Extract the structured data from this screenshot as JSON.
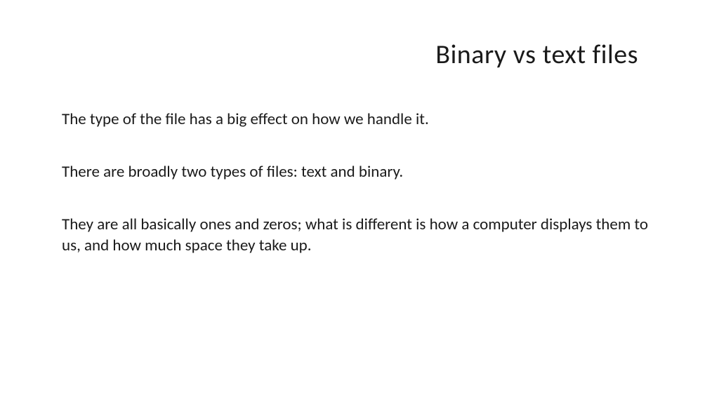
{
  "slide": {
    "title": "Binary vs text files",
    "paragraphs": [
      "The type of the file has a big effect on how we handle it.",
      "There are broadly two types of files: text and binary.",
      "They are all basically ones and zeros; what is different is how a computer displays them to us, and how much space they take up."
    ]
  }
}
